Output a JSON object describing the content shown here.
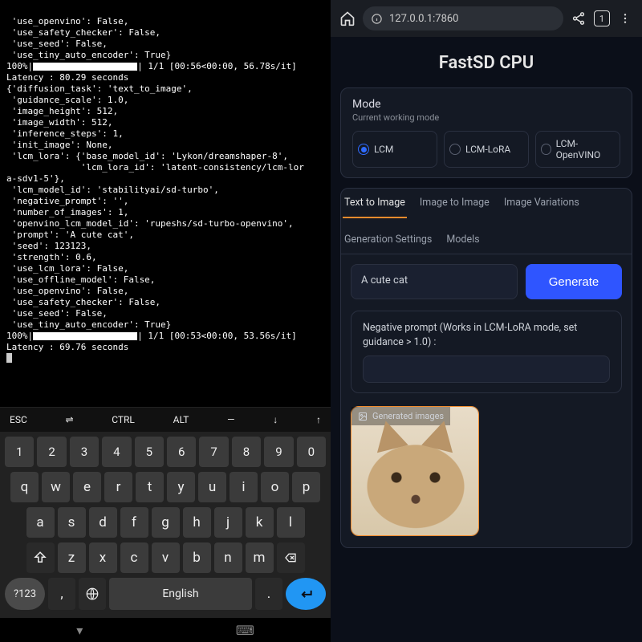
{
  "terminal": {
    "lines_a": [
      " 'use_openvino': False,",
      " 'use_safety_checker': False,",
      " 'use_seed': False,",
      " 'use_tiny_auto_encoder': True}"
    ],
    "progress_a": "100%|",
    "progress_a_tail": "| 1/1 [00:56<00:00, 56.78s/it]",
    "latency_a": "Latency : 80.29 seconds",
    "lines_b": [
      "{'diffusion_task': 'text_to_image',",
      " 'guidance_scale': 1.0,",
      " 'image_height': 512,",
      " 'image_width': 512,",
      " 'inference_steps': 1,",
      " 'init_image': None,",
      " 'lcm_lora': {'base_model_id': 'Lykon/dreamshaper-8',",
      "              'lcm_lora_id': 'latent-consistency/lcm-lor",
      "a-sdv1-5'},",
      " 'lcm_model_id': 'stabilityai/sd-turbo',",
      " 'negative_prompt': '',",
      " 'number_of_images': 1,",
      " 'openvino_lcm_model_id': 'rupeshs/sd-turbo-openvino',",
      " 'prompt': 'A cute cat',",
      " 'seed': 123123,",
      " 'strength': 0.6,",
      " 'use_lcm_lora': False,",
      " 'use_offline_model': False,",
      " 'use_openvino': False,",
      " 'use_safety_checker': False,",
      " 'use_seed': False,",
      " 'use_tiny_auto_encoder': True}"
    ],
    "progress_b": "100%|",
    "progress_b_tail": "| 1/1 [00:53<00:00, 53.56s/it]",
    "latency_b": "Latency : 69.76 seconds"
  },
  "fnrow": {
    "esc": "ESC",
    "slash": "⇌",
    "ctrl": "CTRL",
    "alt": "ALT",
    "dash": "—",
    "down": "↓",
    "up": "↑"
  },
  "keyboard": {
    "row1": [
      "1",
      "2",
      "3",
      "4",
      "5",
      "6",
      "7",
      "8",
      "9",
      "0"
    ],
    "row2": [
      "q",
      "w",
      "e",
      "r",
      "t",
      "y",
      "u",
      "i",
      "o",
      "p"
    ],
    "row3": [
      "a",
      "s",
      "d",
      "f",
      "g",
      "h",
      "j",
      "k",
      "l"
    ],
    "row4": [
      "z",
      "x",
      "c",
      "v",
      "b",
      "n",
      "m"
    ],
    "sym": "?123",
    "comma": ",",
    "lang": "English",
    "dot": ".",
    "space_label": "English"
  },
  "browser": {
    "url": "127.0.0.1:7860",
    "tabs": "1"
  },
  "app": {
    "title": "FastSD CPU",
    "mode": {
      "title": "Mode",
      "subtitle": "Current working mode",
      "options": [
        "LCM",
        "LCM-LoRA",
        "LCM-OpenVINO"
      ],
      "selected": 0
    },
    "tabs": [
      "Text to Image",
      "Image to Image",
      "Image Variations",
      "Generation Settings",
      "Models"
    ],
    "active_tab": 0,
    "prompt_value": "A cute cat",
    "generate_label": "Generate",
    "neg_label": "Negative prompt (Works in LCM-LoRA mode, set guidance > 1.0) :",
    "gallery_label": "Generated images"
  }
}
